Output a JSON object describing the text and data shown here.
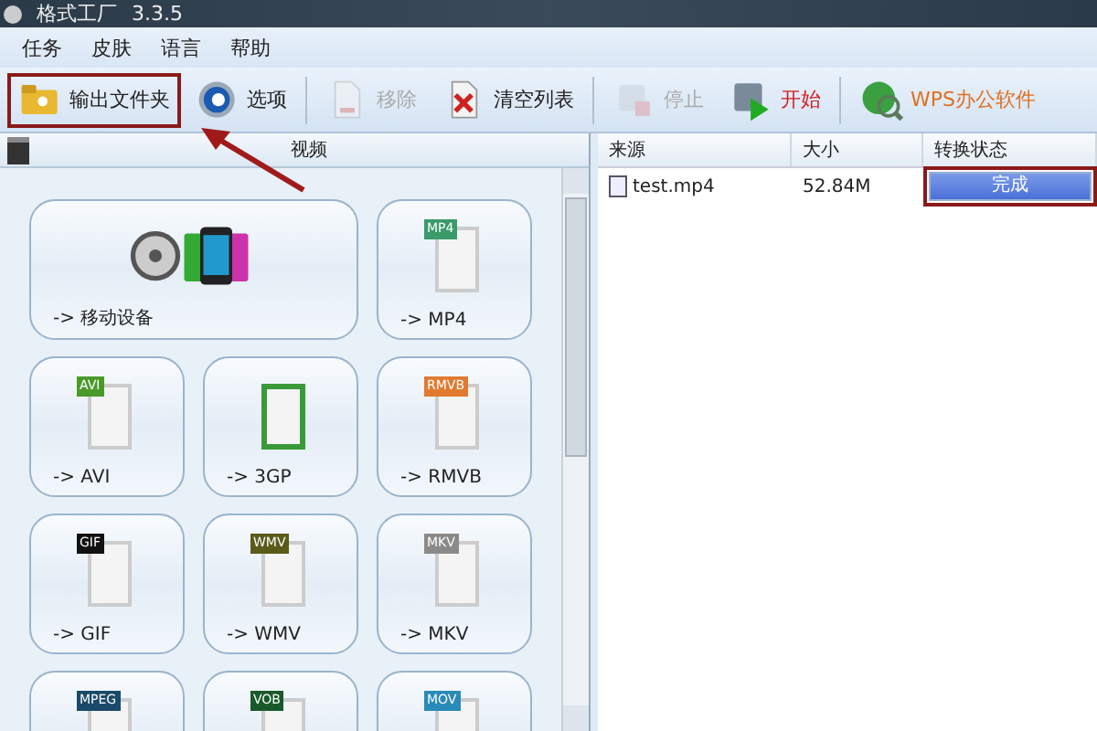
{
  "window": {
    "title": "格式工厂",
    "version": "3.3.5"
  },
  "menu": [
    "任务",
    "皮肤",
    "语言",
    "帮助"
  ],
  "toolbar": [
    {
      "label": "输出文件夹",
      "kind": "folder",
      "disabled": false,
      "highlighted": true
    },
    {
      "label": "选项",
      "kind": "gear",
      "disabled": false,
      "highlighted": false
    },
    {
      "label": "移除",
      "kind": "remove",
      "disabled": true,
      "highlighted": false
    },
    {
      "label": "清空列表",
      "kind": "clear",
      "disabled": false,
      "highlighted": false
    },
    {
      "label": "停止",
      "kind": "stop",
      "disabled": true,
      "highlighted": false
    },
    {
      "label": "开始",
      "kind": "start",
      "disabled": false,
      "highlighted": false
    },
    {
      "label": "WPS办公软件",
      "kind": "promo",
      "disabled": false,
      "highlighted": false
    }
  ],
  "category": {
    "title": "视频"
  },
  "formats": [
    {
      "label": "-> 移动设备",
      "kind": "devices"
    },
    {
      "label": "-> MP4",
      "kind": "file",
      "tag": "MP4",
      "color": "#3a9a6a"
    },
    {
      "label": "-> AVI",
      "kind": "file",
      "tag": "AVI",
      "color": "#4a9a2a"
    },
    {
      "label": "-> 3GP",
      "kind": "file3gp",
      "color": "#3a9a3a"
    },
    {
      "label": "-> RMVB",
      "kind": "file",
      "tag": "RMVB",
      "color": "#e07a30"
    },
    {
      "label": "-> GIF",
      "kind": "file",
      "tag": "GIF",
      "color": "#111111"
    },
    {
      "label": "-> WMV",
      "kind": "file",
      "tag": "WMV",
      "color": "#5a5a1a"
    },
    {
      "label": "-> MKV",
      "kind": "file",
      "tag": "MKV",
      "color": "#8a8a8a"
    },
    {
      "kind": "file",
      "tag": "MPEG",
      "color": "#1a4a6a"
    },
    {
      "kind": "file",
      "tag": "VOB",
      "color": "#1a5a2a"
    },
    {
      "kind": "file",
      "tag": "MOV",
      "color": "#2a8ab8"
    }
  ],
  "table": {
    "columns": [
      "来源",
      "大小",
      "转换状态"
    ],
    "rows": [
      {
        "source": "test.mp4",
        "size": "52.84M",
        "status": "完成",
        "level": 1,
        "highlighted": true
      }
    ]
  }
}
